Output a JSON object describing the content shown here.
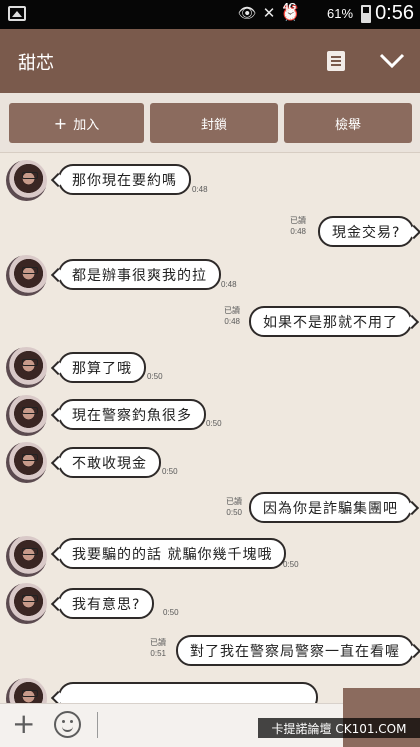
{
  "status_bar": {
    "network": "4G",
    "battery": "61%",
    "time": "0:56"
  },
  "header": {
    "title": "甜芯",
    "menu_icon": "note-menu-icon",
    "collapse_icon": "chevron-down-icon"
  },
  "actions": {
    "add": "加入",
    "block": "封鎖",
    "report": "檢舉"
  },
  "messages": [
    {
      "side": "in",
      "text": "那你現在要約嗎",
      "time": "0:48",
      "read": ""
    },
    {
      "side": "out",
      "text": "現金交易?",
      "time": "0:48",
      "read": "已讀"
    },
    {
      "side": "in",
      "text": "都是辦事很爽我的拉",
      "time": "0:48",
      "read": ""
    },
    {
      "side": "out",
      "text": "如果不是那就不用了",
      "time": "0:48",
      "read": "已讀"
    },
    {
      "side": "in",
      "text": "那算了哦",
      "time": "0:50",
      "read": ""
    },
    {
      "side": "in",
      "text": "現在警察釣魚很多",
      "time": "0:50",
      "read": ""
    },
    {
      "side": "in",
      "text": "不敢收現金",
      "time": "0:50",
      "read": ""
    },
    {
      "side": "out",
      "text": "因為你是詐騙集團吧",
      "time": "0:50",
      "read": "已讀"
    },
    {
      "side": "in",
      "text": "我要騙的的話 就騙你幾千塊哦",
      "time": "0:50",
      "read": ""
    },
    {
      "side": "in",
      "text": "我有意思?",
      "time": "0:50",
      "read": ""
    },
    {
      "side": "out",
      "text": "對了我在警察局警察一直在看喔",
      "time": "0:51",
      "read": "已讀"
    }
  ],
  "watermark": "卡提諾論壇 CK101.COM",
  "colors": {
    "header": "#7a5a4c",
    "button": "#8b6b5e",
    "background": "#efe8df"
  }
}
